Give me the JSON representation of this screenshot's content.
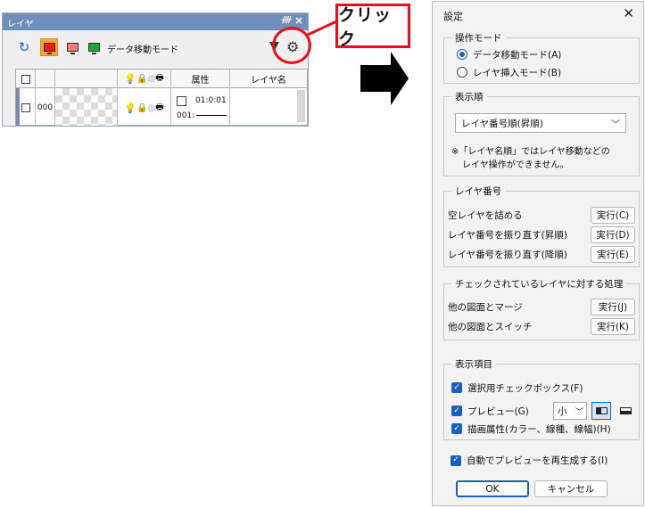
{
  "layer_panel": {
    "title": "レイヤ",
    "pin_glyph": "ᚎ",
    "close_glyph": "×",
    "toolbar": {
      "mode_label": "データ移動モード",
      "icons": [
        "refresh-icon",
        "data-move-mode-icon",
        "layer-insert-mode-icon",
        "display-mode-icon",
        "filter-icon",
        "gear-icon"
      ]
    },
    "columns": {
      "attribute": "属性",
      "layer_name": "レイヤ名"
    },
    "row": {
      "number": "000",
      "time": "01:0:01",
      "attr_text": "001:"
    }
  },
  "callout": {
    "label": "クリック"
  },
  "dialog": {
    "title": "設定",
    "operation_mode": {
      "title": "操作モード",
      "options": [
        "データ移動モード(A)",
        "レイヤ挿入モード(B)"
      ],
      "selected": 0
    },
    "display_order": {
      "title": "表示順",
      "selected": "レイヤ番号順(昇順)",
      "note_line1": "※「レイヤ名順」ではレイヤ移動などの",
      "note_line2": "レイヤ操作ができません。"
    },
    "layer_number": {
      "title": "レイヤ番号",
      "rows": [
        {
          "label": "空レイヤを詰める",
          "button": "実行(C)"
        },
        {
          "label": "レイヤ番号を振り直す(昇順)",
          "button": "実行(D)"
        },
        {
          "label": "レイヤ番号を振り直す(降順)",
          "button": "実行(E)"
        }
      ]
    },
    "checked_processing": {
      "title": "チェックされているレイヤに対する処理",
      "rows": [
        {
          "label": "他の図面とマージ",
          "button": "実行(J)"
        },
        {
          "label": "他の図面とスイッチ",
          "button": "実行(K)"
        }
      ]
    },
    "display_items": {
      "title": "表示項目",
      "items": [
        "選択用チェックボックス(F)",
        "プレビュー(G)",
        "描画属性(カラー、線種、線幅)(H)"
      ],
      "preview_size": "小"
    },
    "auto_regenerate": "自動でプレビューを再生成する(I)",
    "ok": "OK",
    "cancel": "キャンセル"
  }
}
